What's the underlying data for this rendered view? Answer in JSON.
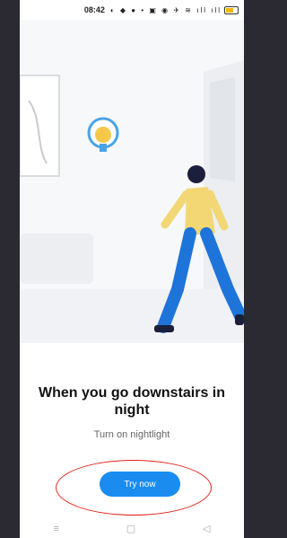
{
  "status_bar": {
    "time": "08:42",
    "icons": "◐ ◆ ● • ▣ ◉ ✈ ≋ ıll ıll",
    "battery_level": 0.6
  },
  "onboarding": {
    "title": "When you go downstairs in night",
    "subtitle": "Turn on nightlight",
    "try_button_label": "Try now"
  },
  "nav_bar": {
    "menu_icon": "≡",
    "home_icon": "▢",
    "back_icon": "◁"
  },
  "colors": {
    "accent": "#1a8cf0",
    "annotation": "#e2231a",
    "lamp": "#f5c84a",
    "jacket": "#f2d774",
    "pants": "#1f74d9"
  }
}
